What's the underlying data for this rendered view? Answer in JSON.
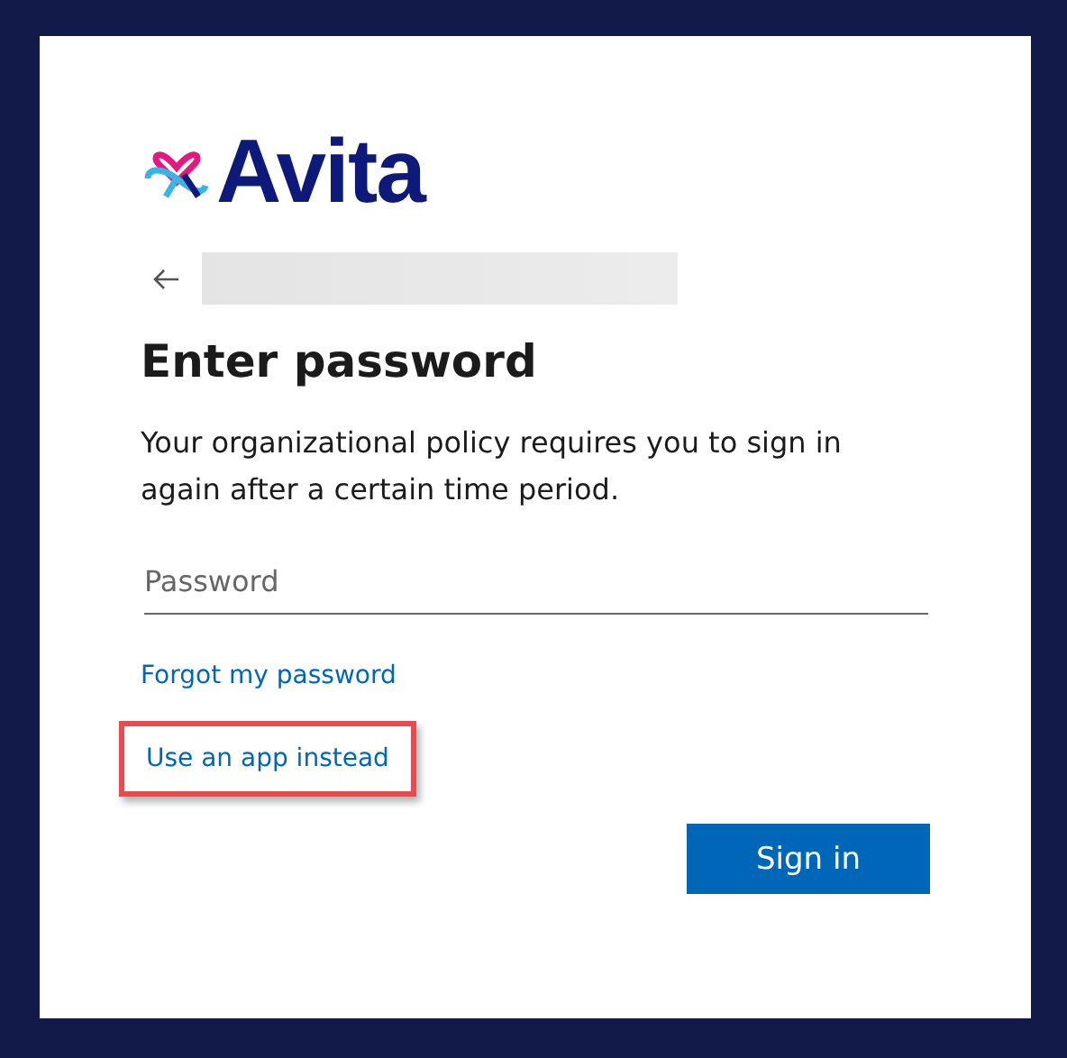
{
  "logo": {
    "text": "Avita"
  },
  "heading": "Enter password",
  "message": "Your organizational policy requires you to sign in again after a certain time period.",
  "password_field": {
    "placeholder": "Password"
  },
  "links": [
    {
      "label": "Forgot my password",
      "highlighted": false
    },
    {
      "label": "Use an app instead",
      "highlighted": true
    }
  ],
  "buttons": [
    {
      "label": "Sign in"
    }
  ]
}
